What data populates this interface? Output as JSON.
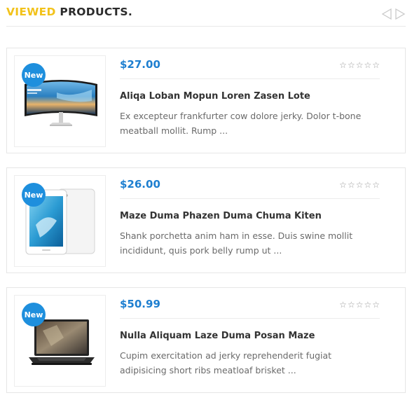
{
  "header": {
    "title_accent": "VIEWED",
    "title_rest": "PRODUCTS.",
    "prev_icon": "chevron-left-outline-icon",
    "next_icon": "chevron-right-outline-icon"
  },
  "colors": {
    "accent": "#f2c21a",
    "price": "#1e7fd0",
    "badge": "#1e8fdd"
  },
  "products": [
    {
      "badge": "New",
      "price": "$27.00",
      "rating": 0,
      "name": "Aliqa Loban Mopun Loren Zasen Lote",
      "description": "Ex excepteur frankfurter cow dolore jerky. Dolor t-bone meatball mollit. Rump ...",
      "image": "curved-monitor"
    },
    {
      "badge": "New",
      "price": "$26.00",
      "rating": 0,
      "name": "Maze Duma Phazen Duma Chuma Kiten",
      "description": "Shank porchetta anim ham in esse. Duis swine mollit incididunt, quis pork belly rump ut ...",
      "image": "tablet"
    },
    {
      "badge": "New",
      "price": "$50.99",
      "rating": 0,
      "name": "Nulla Aliquam Laze Duma Posan Maze",
      "description": "Cupim exercitation ad jerky reprehenderit fugiat adipisicing short ribs meatloaf brisket ...",
      "image": "laptop"
    }
  ]
}
